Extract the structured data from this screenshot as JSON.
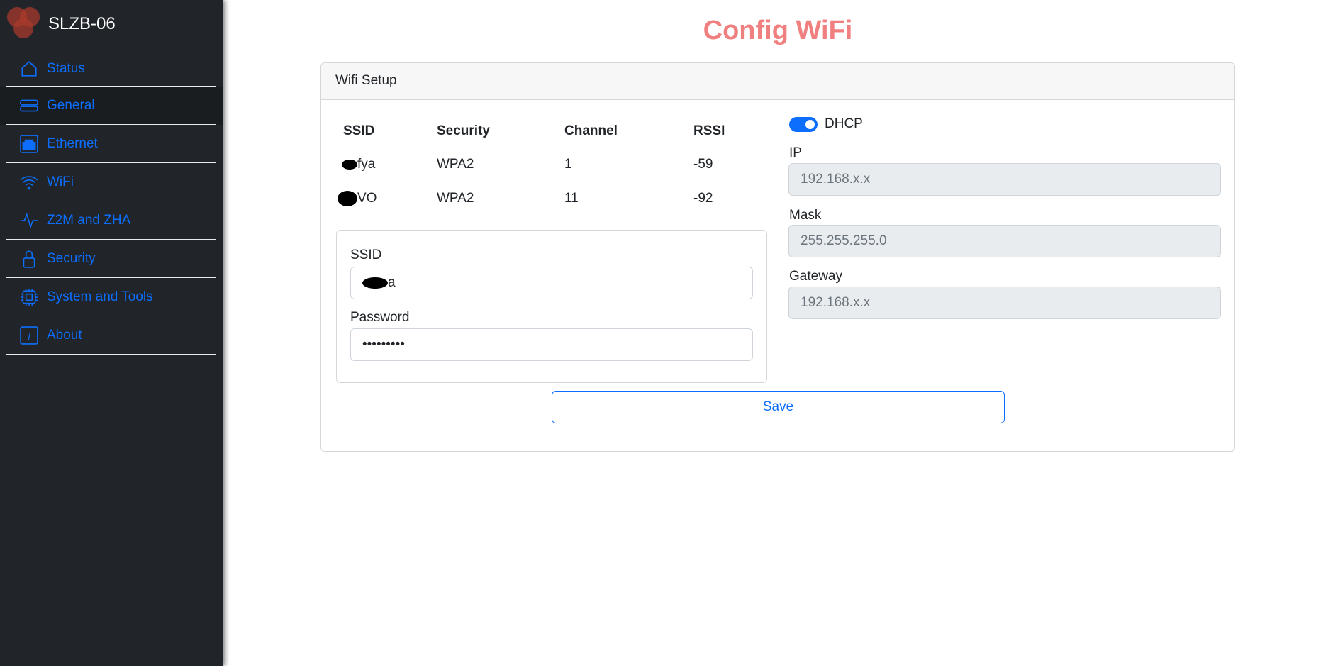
{
  "brand": "SLZB-06",
  "accent": "#0d6efd",
  "title_color": "#f08080",
  "nav": [
    {
      "label": "Status",
      "icon": "house-icon"
    },
    {
      "label": "General",
      "icon": "server-icon",
      "active": true
    },
    {
      "label": "Ethernet",
      "icon": "ethernet-icon"
    },
    {
      "label": "WiFi",
      "icon": "wifi-icon"
    },
    {
      "label": "Z2M and ZHA",
      "icon": "activity-icon"
    },
    {
      "label": "Security",
      "icon": "lock-icon"
    },
    {
      "label": "System and Tools",
      "icon": "cpu-icon"
    },
    {
      "label": "About",
      "icon": "info-icon"
    }
  ],
  "page_title": "Config WiFi",
  "card": {
    "header": "Wifi Setup",
    "table": {
      "columns": [
        "SSID",
        "Security",
        "Channel",
        "RSSI"
      ],
      "rows": [
        {
          "ssid": "fya",
          "security": "WPA2",
          "channel": "1",
          "rssi": "-59"
        },
        {
          "ssid": "VO",
          "security": "WPA2",
          "channel": "11",
          "rssi": "-92"
        }
      ]
    },
    "ssid_label": "SSID",
    "ssid_value": "a",
    "password_label": "Password",
    "password_value": "•••••••••",
    "save_label": "Save",
    "dhcp_label": "DHCP",
    "dhcp_on": true,
    "ip_label": "IP",
    "ip_value": "192.168.x.x",
    "mask_label": "Mask",
    "mask_value": "255.255.255.0",
    "gateway_label": "Gateway",
    "gateway_value": "192.168.x.x"
  }
}
